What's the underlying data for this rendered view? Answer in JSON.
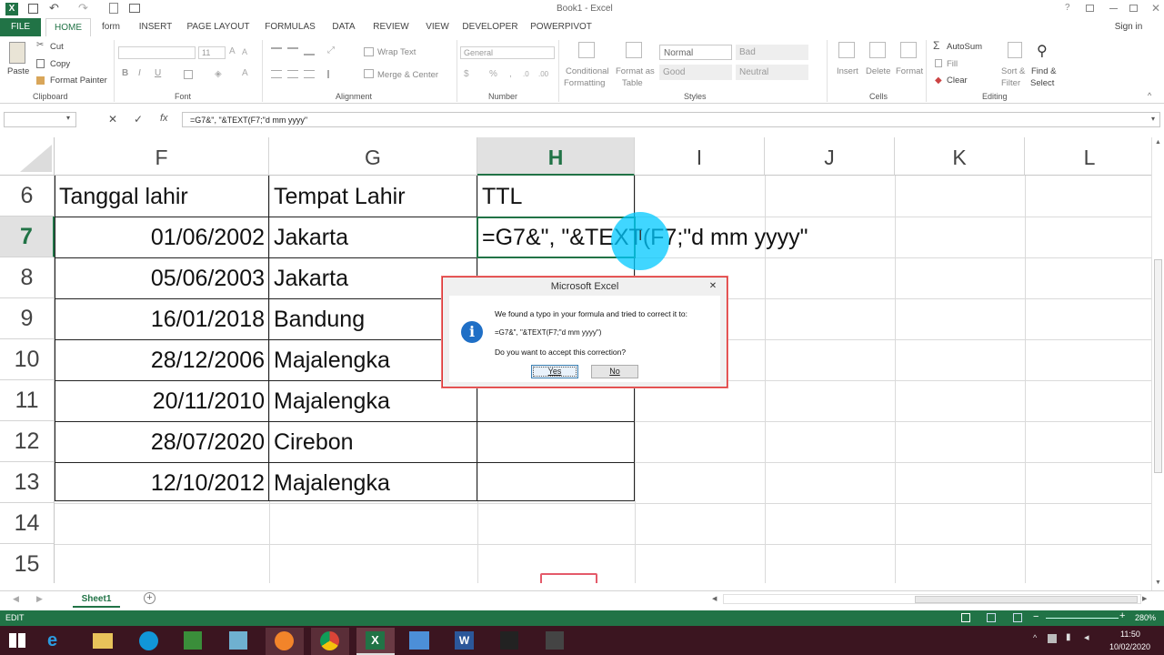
{
  "window": {
    "title": "Book1 - Excel",
    "sign_in": "Sign in"
  },
  "tabs": [
    "FILE",
    "HOME",
    "form",
    "INSERT",
    "PAGE LAYOUT",
    "FORMULAS",
    "DATA",
    "REVIEW",
    "VIEW",
    "DEVELOPER",
    "POWERPIVOT"
  ],
  "ribbon": {
    "clipboard": {
      "paste": "Paste",
      "cut": "Cut",
      "copy": "Copy",
      "format_painter": "Format Painter",
      "label": "Clipboard"
    },
    "font": {
      "size": "11",
      "label": "Font"
    },
    "alignment": {
      "wrap_text": "Wrap Text",
      "merge_center": "Merge & Center",
      "label": "Alignment"
    },
    "number": {
      "format": "General",
      "label": "Number"
    },
    "styles": {
      "conditional": "Conditional",
      "formatting": "Formatting",
      "format_as": "Format as",
      "table": "Table",
      "normal": "Normal",
      "bad": "Bad",
      "good": "Good",
      "neutral": "Neutral",
      "label": "Styles"
    },
    "cells": {
      "insert": "Insert",
      "delete": "Delete",
      "format": "Format",
      "label": "Cells"
    },
    "editing": {
      "autosum": "AutoSum",
      "fill": "Fill",
      "clear": "Clear",
      "sort": "Sort &",
      "filter": "Filter",
      "find": "Find &",
      "select": "Select",
      "label": "Editing"
    }
  },
  "formula_bar": {
    "name_box": "",
    "formula": "=G7&\", \"&TEXT(F7;\"d mm yyyy\""
  },
  "columns": [
    "F",
    "G",
    "H",
    "I",
    "J",
    "K",
    "L"
  ],
  "rows": [
    {
      "num": "6",
      "f": "Tanggal lahir",
      "g": "Tempat Lahir",
      "h": "TTL"
    },
    {
      "num": "7",
      "f": "01/06/2002",
      "g": "Jakarta",
      "h": "=G7&\", \"&TEXT(F7;\"d mm yyyy\""
    },
    {
      "num": "8",
      "f": "05/06/2003",
      "g": "Jakarta",
      "h": ""
    },
    {
      "num": "9",
      "f": "16/01/2018",
      "g": "Bandung",
      "h": ""
    },
    {
      "num": "10",
      "f": "28/12/2006",
      "g": "Majalengka",
      "h": ""
    },
    {
      "num": "11",
      "f": "20/11/2010",
      "g": "Majalengka",
      "h": ""
    },
    {
      "num": "12",
      "f": "28/07/2020",
      "g": "Cirebon",
      "h": ""
    },
    {
      "num": "13",
      "f": "12/10/2012",
      "g": "Majalengka",
      "h": ""
    },
    {
      "num": "14",
      "f": "",
      "g": "",
      "h": ""
    },
    {
      "num": "15",
      "f": "",
      "g": "",
      "h": ""
    }
  ],
  "dialog": {
    "title": "Microsoft Excel",
    "message": "We found a typo in your formula and tried to correct it to:",
    "correction": "=G7&\", \"&TEXT(F7;\"d mm yyyy\")",
    "question": "Do you want to accept this correction?",
    "yes": "Yes",
    "no": "No"
  },
  "sheet_tab": "Sheet1",
  "status": {
    "mode": "EDIT",
    "zoom": "280%"
  },
  "clock": {
    "time": "11:50",
    "date": "10/02/2020"
  },
  "colors": {
    "excel_green": "#217346",
    "header_selected": "#217346",
    "dialog_border": "#dd3333",
    "taskbar": "#3b1520"
  }
}
